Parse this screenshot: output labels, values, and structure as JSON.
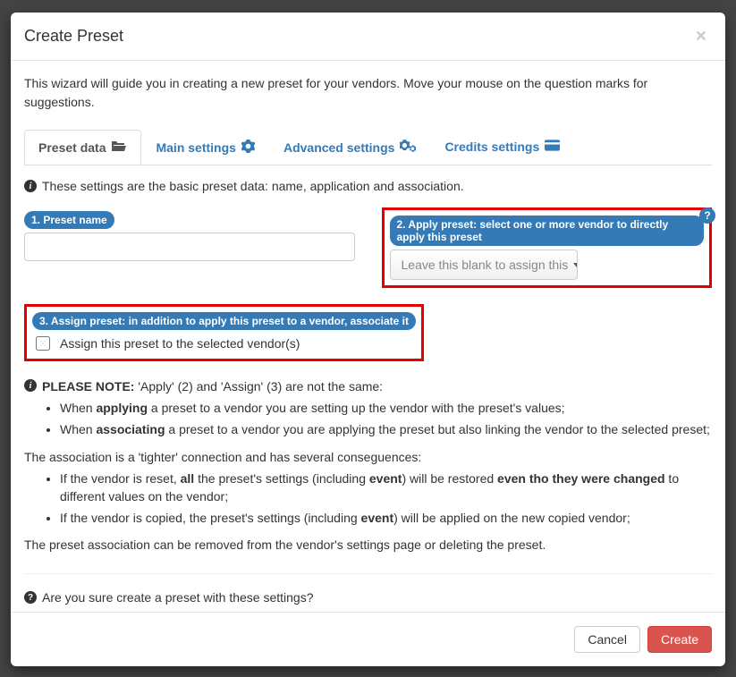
{
  "modal": {
    "title": "Create Preset",
    "intro": "This wizard will guide you in creating a new preset for your vendors. Move your mouse on the question marks for suggestions."
  },
  "tabs": [
    {
      "label": "Preset data"
    },
    {
      "label": "Main settings"
    },
    {
      "label": "Advanced settings"
    },
    {
      "label": "Credits settings"
    }
  ],
  "tab_desc": "These settings are the basic preset data: name, application and association.",
  "form": {
    "preset_name": {
      "pill": "1. Preset name",
      "value": ""
    },
    "apply_preset": {
      "pill": "2. Apply preset: select one or more vendor to directly apply this preset",
      "placeholder": "Leave this blank to assign this"
    },
    "assign_preset": {
      "pill": "3. Assign preset: in addition to apply this preset to a vendor, associate it",
      "label": "Assign this preset to the selected vendor(s)"
    }
  },
  "note": {
    "lead_strong": "PLEASE NOTE:",
    "lead_rest": " 'Apply' (2) and 'Assign' (3) are not the same:",
    "b1_pre": "When ",
    "b1_strong": "applying",
    "b1_post": " a preset to a vendor you are setting up the vendor with the preset's values;",
    "b2_pre": "When ",
    "b2_strong": "associating",
    "b2_post": " a preset to a vendor you are applying the preset but also linking the vendor to the selected preset;",
    "assoc_intro": "The association is a 'tighter' connection and has several conseguences:",
    "a1_pre": "If the vendor is reset, ",
    "a1_s1": "all",
    "a1_mid1": " the preset's settings (including ",
    "a1_s2": "event",
    "a1_mid2": ") will be restored ",
    "a1_s3": "even tho they were changed",
    "a1_post": " to different values on the vendor;",
    "a2_pre": "If the vendor is copied, the preset's settings (including ",
    "a2_s1": "event",
    "a2_post": ") will be applied on the new copied vendor;",
    "assoc_outro": "The preset association can be removed from the vendor's settings page or deleting the preset."
  },
  "confirm": "Are you sure create a preset with these settings?",
  "footer": {
    "cancel": "Cancel",
    "create": "Create"
  }
}
